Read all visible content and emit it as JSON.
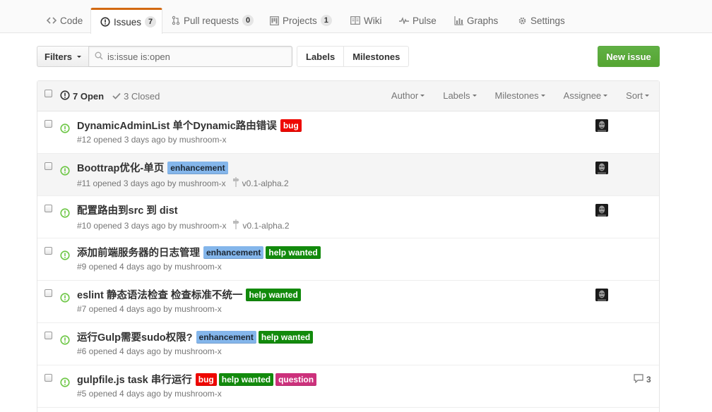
{
  "tabs": [
    {
      "label": "Code",
      "icon": "code-icon"
    },
    {
      "label": "Issues",
      "count": "7",
      "icon": "issue-opened-icon",
      "selected": true
    },
    {
      "label": "Pull requests",
      "count": "0",
      "icon": "git-pull-request-icon"
    },
    {
      "label": "Projects",
      "count": "1",
      "icon": "project-icon"
    },
    {
      "label": "Wiki",
      "icon": "book-icon"
    },
    {
      "label": "Pulse",
      "icon": "pulse-icon"
    },
    {
      "label": "Graphs",
      "icon": "graph-icon"
    },
    {
      "label": "Settings",
      "icon": "gear-icon"
    }
  ],
  "filters": {
    "button_label": "Filters",
    "search_value": "is:issue is:open",
    "labels_link": "Labels",
    "milestones_link": "Milestones",
    "new_issue_label": "New issue"
  },
  "table_header": {
    "open_count": "7 Open",
    "closed_count": "3 Closed",
    "sorts": [
      "Author",
      "Labels",
      "Milestones",
      "Assignee",
      "Sort"
    ]
  },
  "colors": {
    "open_icon": "#6cc644",
    "accent_tab": "#d26911",
    "label_bug": "#ee0701",
    "label_enhancement": "#84b6eb",
    "label_help_wanted": "#128a0c",
    "label_question": "#cc317c"
  },
  "issues": [
    {
      "title": "DynamicAdminList 单个Dynamic路由错误",
      "labels": [
        {
          "name": "bug",
          "bg": "#ee0701",
          "fg": "#fff"
        }
      ],
      "meta": "#12 opened 3 days ago by mushroom-x",
      "milestone": "",
      "assignee": true,
      "comments": ""
    },
    {
      "title": "Boottrap优化-单页",
      "labels": [
        {
          "name": "enhancement",
          "bg": "#84b6eb",
          "fg": "#1c2733"
        }
      ],
      "meta": "#11 opened 3 days ago by mushroom-x",
      "milestone": "v0.1-alpha.2",
      "assignee": true,
      "comments": ""
    },
    {
      "title": "配置路由到src 到 dist",
      "labels": [],
      "meta": "#10 opened 3 days ago by mushroom-x",
      "milestone": "v0.1-alpha.2",
      "assignee": true,
      "comments": ""
    },
    {
      "title": "添加前端服务器的日志管理",
      "labels": [
        {
          "name": "enhancement",
          "bg": "#84b6eb",
          "fg": "#1c2733"
        },
        {
          "name": "help wanted",
          "bg": "#128a0c",
          "fg": "#fff"
        }
      ],
      "meta": "#9 opened 4 days ago by mushroom-x",
      "milestone": "",
      "assignee": false,
      "comments": ""
    },
    {
      "title": "eslint 静态语法检查 检查标准不统一",
      "labels": [
        {
          "name": "help wanted",
          "bg": "#128a0c",
          "fg": "#fff"
        }
      ],
      "meta": "#7 opened 4 days ago by mushroom-x",
      "milestone": "",
      "assignee": true,
      "comments": ""
    },
    {
      "title": "运行Gulp需要sudo权限?",
      "labels": [
        {
          "name": "enhancement",
          "bg": "#84b6eb",
          "fg": "#1c2733"
        },
        {
          "name": "help wanted",
          "bg": "#128a0c",
          "fg": "#fff"
        }
      ],
      "meta": "#6 opened 4 days ago by mushroom-x",
      "milestone": "",
      "assignee": false,
      "comments": ""
    },
    {
      "title": "gulpfile.js task 串行运行",
      "labels": [
        {
          "name": "bug",
          "bg": "#ee0701",
          "fg": "#fff"
        },
        {
          "name": "help wanted",
          "bg": "#128a0c",
          "fg": "#fff"
        },
        {
          "name": "question",
          "bg": "#cc317c",
          "fg": "#fff"
        }
      ],
      "meta": "#5 opened 4 days ago by mushroom-x",
      "milestone": "",
      "assignee": false,
      "comments": "3"
    }
  ]
}
